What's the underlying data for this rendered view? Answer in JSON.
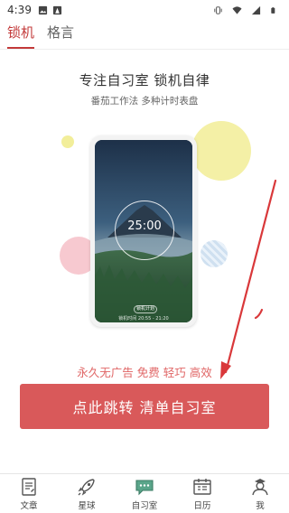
{
  "status_bar": {
    "time": "4:39"
  },
  "tabs": [
    {
      "label": "锁机",
      "active": true
    },
    {
      "label": "格言",
      "active": false
    }
  ],
  "promo": {
    "title": "专注自习室 锁机自律",
    "subtitle": "番茄工作法   多种计时表盘",
    "phone": {
      "timer": "25:00",
      "plan_label": "锁机计划",
      "lock_info": "锁机时间 20:55 - 21:20"
    }
  },
  "tagline": "永久无广告 免费 轻巧 高效",
  "cta_label": "点此跳转 清单自习室",
  "colors": {
    "accent": "#c33a3a",
    "cta": "#d9595a",
    "tagline": "#e06666",
    "arrow": "#d9383a"
  },
  "nav": [
    {
      "label": "文章",
      "icon": "article-icon"
    },
    {
      "label": "星球",
      "icon": "rocket-icon"
    },
    {
      "label": "自习室",
      "icon": "chat-icon"
    },
    {
      "label": "日历",
      "icon": "calendar-icon"
    },
    {
      "label": "我",
      "icon": "user-icon"
    }
  ]
}
